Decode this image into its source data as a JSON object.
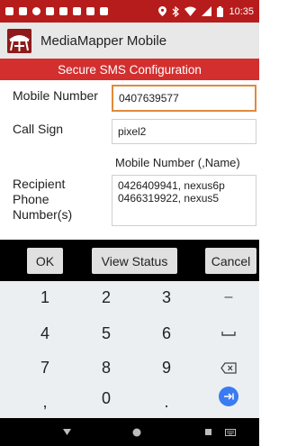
{
  "status_bar": {
    "time": "10:35"
  },
  "app_bar": {
    "title": "MediaMapper Mobile"
  },
  "header": {
    "title": "Secure SMS Configuration"
  },
  "form": {
    "mobile_number_label": "Mobile Number",
    "mobile_number_value": "0407639577",
    "call_sign_label": "Call Sign",
    "call_sign_value": "pixel2",
    "recipients_hint": "Mobile Number (,Name)",
    "recipients_label_line1": "Recipient",
    "recipients_label_line2": "Phone",
    "recipients_label_line3": "Number(s)",
    "recipients_line1": "0426409941, nexus6p",
    "recipients_line2": "0466319922, nexus5"
  },
  "actions": {
    "ok": "OK",
    "view_status": "View Status",
    "cancel": "Cancel"
  },
  "keyboard": {
    "k1": "1",
    "k2": "2",
    "k3": "3",
    "k_minus": "–",
    "k4": "4",
    "k5": "5",
    "k6": "6",
    "k7": "7",
    "k8": "8",
    "k9": "9",
    "k_comma": ",",
    "k0": "0",
    "k_period": "."
  },
  "colors": {
    "status_bar": "#b71c1c",
    "header": "#d32f2f",
    "focus_border": "#e08a3a",
    "enter_key": "#3a7bf4"
  },
  "icons": [
    "app-logo-icon",
    "space-icon",
    "backspace-icon",
    "enter-icon",
    "back-icon",
    "home-icon",
    "recents-icon",
    "keyboard-switch-icon"
  ]
}
